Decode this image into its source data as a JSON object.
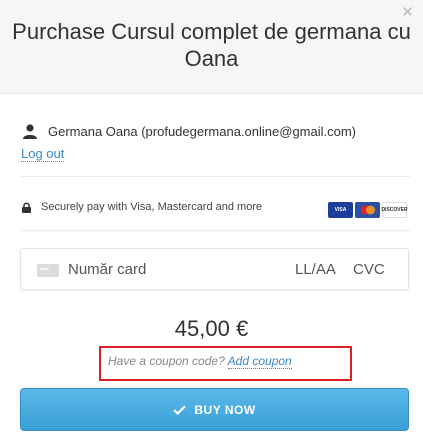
{
  "header": {
    "title": "Purchase Cursul complet de germana cu Oana",
    "close_icon": "close-icon"
  },
  "account": {
    "user": "Germana Oana (profudegermana.online@gmail.com)",
    "logout_label": "Log out",
    "icon": "user-icon"
  },
  "security": {
    "text": "Securely pay with Visa, Mastercard and more",
    "icon": "lock-icon",
    "cards": {
      "visa": "VISA",
      "discover": "DISCOVER"
    }
  },
  "card_form": {
    "number_placeholder": "Număr card",
    "expiry_placeholder": "LL/AA",
    "cvc_placeholder": "CVC"
  },
  "price": "45,00 €",
  "coupon": {
    "prompt": "Have a coupon code?",
    "link": "Add coupon"
  },
  "buy_button": {
    "label": "BUY NOW",
    "icon": "checkmark-icon",
    "color": "#4aa8de"
  },
  "colors": {
    "link": "#3a89c9",
    "highlight_border": "#d81f26"
  }
}
